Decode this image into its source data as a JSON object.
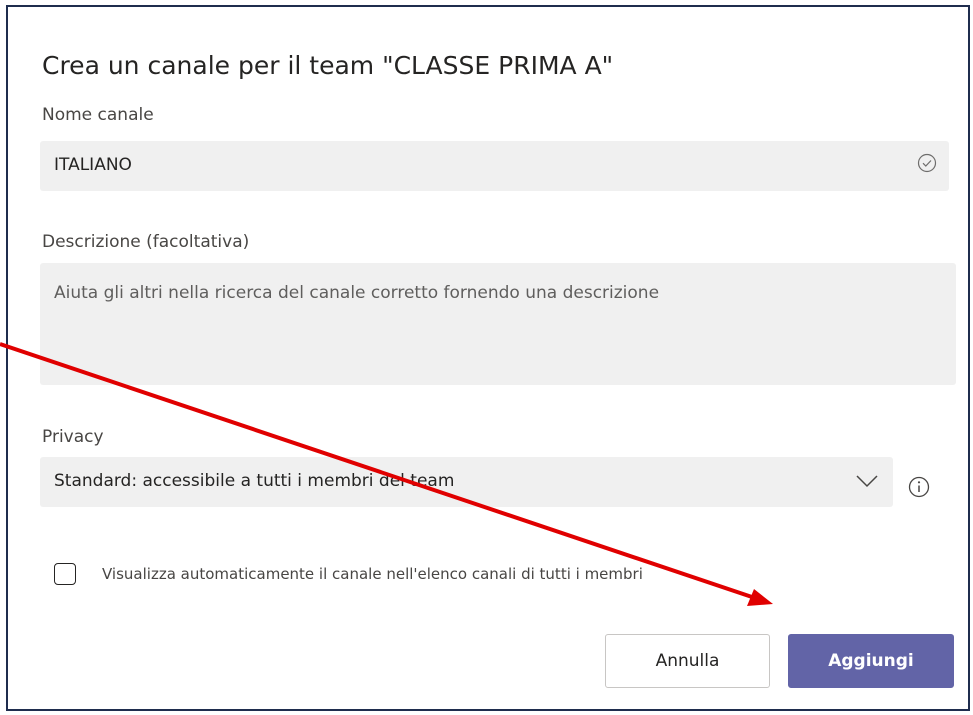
{
  "dialog": {
    "title": "Crea un canale per il team \"CLASSE PRIMA A\""
  },
  "channel_name": {
    "label": "Nome canale",
    "value": "ITALIANO",
    "status_icon": "check-circle-icon"
  },
  "description": {
    "label": "Descrizione (facoltativa)",
    "placeholder": "Aiuta gli altri nella ricerca del canale corretto fornendo una descrizione"
  },
  "privacy": {
    "label": "Privacy",
    "selected": "Standard: accessibile a tutti i membri del team",
    "dropdown_icon": "chevron-down-icon",
    "info_icon": "info-icon"
  },
  "auto_show": {
    "label": "Visualizza automaticamente il canale nell'elenco canali di tutti i membri",
    "checked": false
  },
  "buttons": {
    "cancel_label": "Annulla",
    "add_label": "Aggiungi"
  },
  "colors": {
    "accent": "#6264a7",
    "field_bg": "#f0f0f0",
    "annotation_arrow": "#e00000",
    "dialog_border": "#1f2d4e"
  }
}
